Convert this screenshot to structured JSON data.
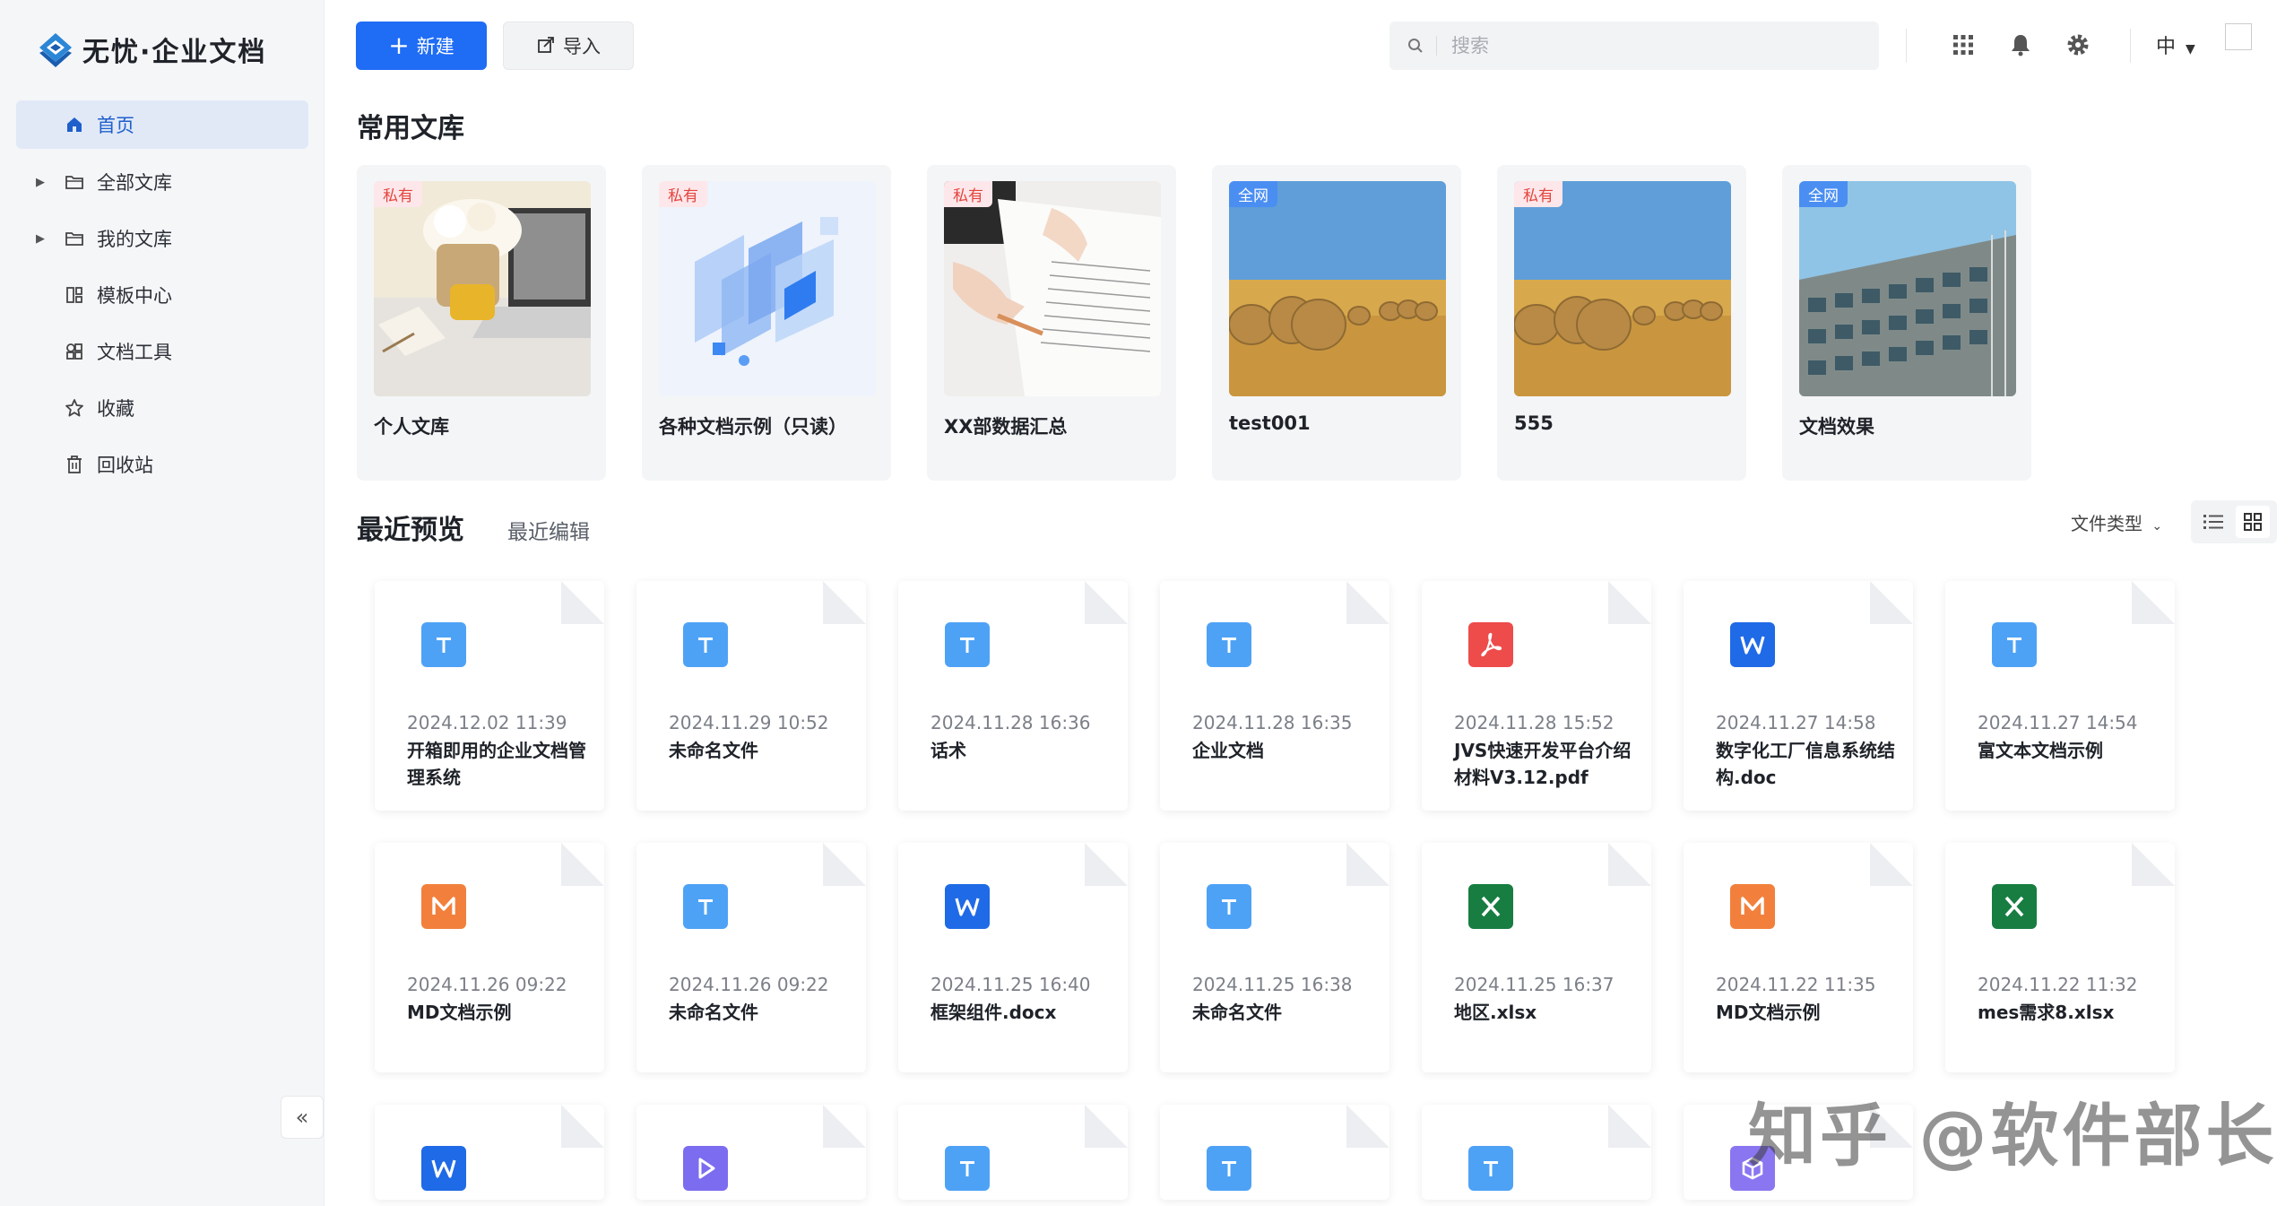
{
  "app": {
    "logo_text": "无忧·企业文档"
  },
  "sidebar": {
    "items": [
      {
        "label": "首页",
        "icon": "home-icon",
        "active": true,
        "expandable": false
      },
      {
        "label": "全部文库",
        "icon": "folder-icon",
        "active": false,
        "expandable": true
      },
      {
        "label": "我的文库",
        "icon": "folder-icon",
        "active": false,
        "expandable": true
      },
      {
        "label": "模板中心",
        "icon": "template-icon",
        "active": false,
        "expandable": false
      },
      {
        "label": "文档工具",
        "icon": "tools-icon",
        "active": false,
        "expandable": false
      },
      {
        "label": "收藏",
        "icon": "star-icon",
        "active": false,
        "expandable": false
      },
      {
        "label": "回收站",
        "icon": "trash-icon",
        "active": false,
        "expandable": false
      }
    ],
    "collapse_label": "«"
  },
  "toolbar": {
    "new_label": "新建",
    "import_label": "导入",
    "search_placeholder": "搜索",
    "lang_label": "中"
  },
  "libraries": {
    "title": "常用文库",
    "items": [
      {
        "tag": "私有",
        "tag_type": "private",
        "name": "个人文库",
        "image": "desk-photo"
      },
      {
        "tag": "私有",
        "tag_type": "private",
        "name": "各种文档示例（只读）",
        "image": "blue-isometric-illustration"
      },
      {
        "tag": "私有",
        "tag_type": "private",
        "name": "XX部数据汇总",
        "image": "writing-hand-photo"
      },
      {
        "tag": "全网",
        "tag_type": "public",
        "name": "test001",
        "image": "hay-bales-photo"
      },
      {
        "tag": "私有",
        "tag_type": "private",
        "name": "555",
        "image": "hay-bales-photo"
      },
      {
        "tag": "全网",
        "tag_type": "public",
        "name": "文档效果",
        "image": "building-photo"
      }
    ]
  },
  "recent": {
    "tab_preview": "最近预览",
    "tab_edit": "最近编辑",
    "filter_label": "文件类型",
    "files": [
      {
        "type": "T",
        "cls": "i-t",
        "date": "2024.12.02 11:39",
        "name": "开箱即用的企业文档管理系统"
      },
      {
        "type": "T",
        "cls": "i-t",
        "date": "2024.11.29 10:52",
        "name": "未命名文件"
      },
      {
        "type": "T",
        "cls": "i-t",
        "date": "2024.11.28 16:36",
        "name": "话术"
      },
      {
        "type": "T",
        "cls": "i-t",
        "date": "2024.11.28 16:35",
        "name": "企业文档"
      },
      {
        "type": "PDF",
        "cls": "i-pdf",
        "date": "2024.11.28 15:52",
        "name": "JVS快速开发平台介绍材料V3.12.pdf"
      },
      {
        "type": "W",
        "cls": "i-w",
        "date": "2024.11.27 14:58",
        "name": "数字化工厂信息系统结构.doc"
      },
      {
        "type": "T",
        "cls": "i-t",
        "date": "2024.11.27 14:54",
        "name": "富文本文档示例"
      },
      {
        "type": "M",
        "cls": "i-m",
        "date": "2024.11.26 09:22",
        "name": "MD文档示例"
      },
      {
        "type": "T",
        "cls": "i-t",
        "date": "2024.11.26 09:22",
        "name": "未命名文件"
      },
      {
        "type": "W",
        "cls": "i-w",
        "date": "2024.11.25 16:40",
        "name": "框架组件.docx"
      },
      {
        "type": "T",
        "cls": "i-t",
        "date": "2024.11.25 16:38",
        "name": "未命名文件"
      },
      {
        "type": "X",
        "cls": "i-x",
        "date": "2024.11.25 16:37",
        "name": "地区.xlsx"
      },
      {
        "type": "M",
        "cls": "i-m",
        "date": "2024.11.22 11:35",
        "name": "MD文档示例"
      },
      {
        "type": "X",
        "cls": "i-x",
        "date": "2024.11.22 11:32",
        "name": "mes需求8.xlsx"
      },
      {
        "type": "W",
        "cls": "i-w",
        "date": "",
        "name": ""
      },
      {
        "type": "P",
        "cls": "i-play",
        "date": "",
        "name": ""
      },
      {
        "type": "T",
        "cls": "i-t",
        "date": "",
        "name": ""
      },
      {
        "type": "T",
        "cls": "i-t",
        "date": "",
        "name": ""
      },
      {
        "type": "T",
        "cls": "i-t",
        "date": "",
        "name": ""
      },
      {
        "type": "C",
        "cls": "i-cube",
        "date": "",
        "name": ""
      }
    ]
  },
  "overlay": {
    "watermark": "知乎 @软件部长"
  },
  "colors": {
    "primary": "#1f6cf5",
    "sidebar_bg": "#f5f6f8",
    "active_bg": "#e1e9f7"
  }
}
